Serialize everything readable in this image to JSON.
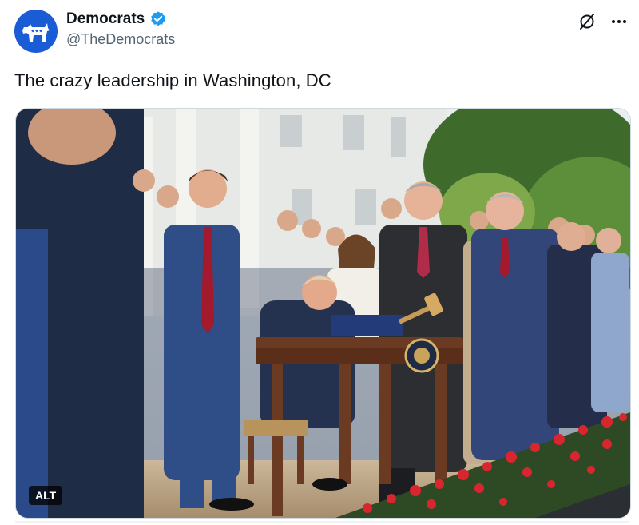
{
  "author": {
    "display_name": "Democrats",
    "handle": "@TheDemocrats",
    "avatar_icon": "donkey-icon",
    "avatar_color": "#1a5bd6",
    "verified_icon": "verified-badge-icon",
    "verified_color": "#1d9bf0"
  },
  "actions": {
    "grok_icon": "grok-icon",
    "more_icon": "more-icon"
  },
  "tweet": {
    "text": "The crazy leadership in Washington, DC"
  },
  "media": {
    "alt_label": "ALT",
    "photo_scene": "bill-signing-ceremony-photo"
  }
}
